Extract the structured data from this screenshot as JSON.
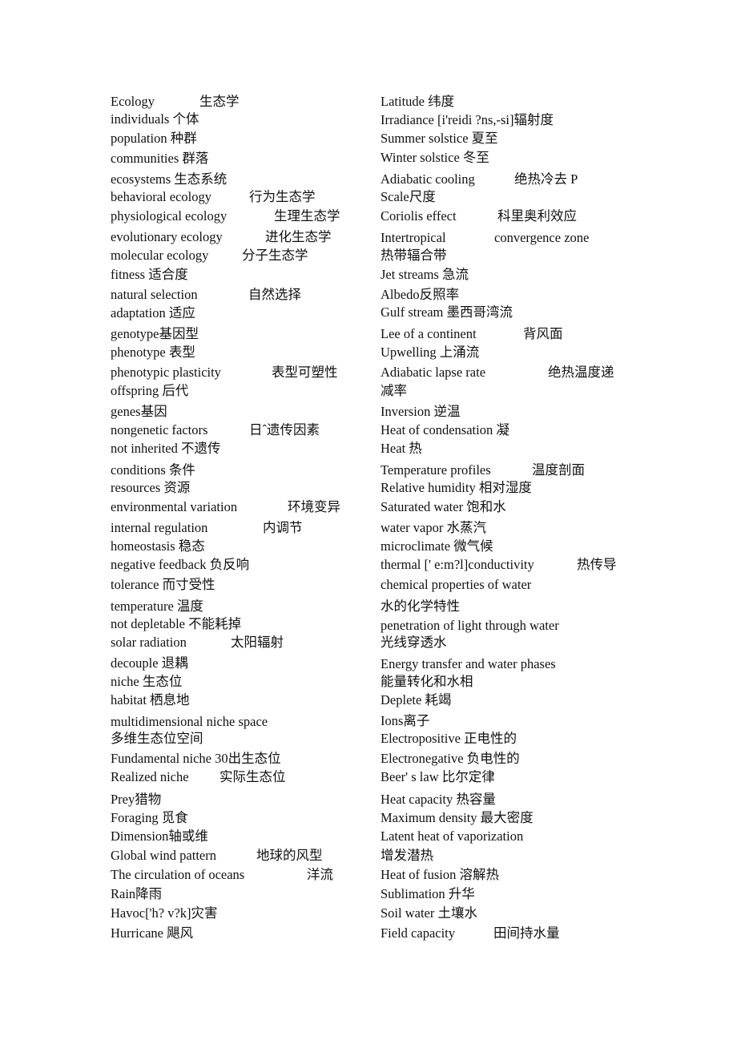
{
  "left": [
    {
      "term": "Ecology",
      "cn": "生态学"
    },
    {
      "term": "individuals 个体"
    },
    {
      "term": "population 种群"
    },
    {
      "term": "communities 群落"
    },
    {
      "term": "ecosystems 生态系统"
    },
    {
      "term": "behavioral ecology",
      "cn": "行为生态学"
    },
    {
      "term": "physiological ecology",
      "cn": "生理生态学"
    },
    {
      "term": "evolutionary ecology",
      "cn": "进化生态学"
    },
    {
      "term": "molecular ecology",
      "cn": "分子生态学"
    },
    {
      "term": "fitness 适合度"
    },
    {
      "term": "natural selection",
      "cn": "自然选择"
    },
    {
      "term": "adaptation 适应"
    },
    {
      "term": "genotype基因型"
    },
    {
      "term": "phenotype 表型"
    },
    {
      "term": "phenotypic plasticity",
      "cn": "表型可塑性"
    },
    {
      "term": "offspring 后代"
    },
    {
      "term": "genes基因"
    },
    {
      "term": "nongenetic factors",
      "cn": "日ˆ遗传因素"
    },
    {
      "term": "not inherited 不遗传"
    },
    {
      "term": "conditions 条件"
    },
    {
      "term": "resources 资源"
    },
    {
      "term": "environmental variation",
      "cn": "环境变异"
    },
    {
      "term": "internal regulation",
      "cn": "内调节"
    },
    {
      "term": "homeostasis 稳态"
    },
    {
      "term": "negative feedback 负反响"
    },
    {
      "term": "tolerance 而寸受性"
    },
    {
      "term": "temperature 温度"
    },
    {
      "term": "not depletable 不能耗掉"
    },
    {
      "term": "solar radiation",
      "cn": "太阳辐射"
    },
    {
      "term": "decouple 退耦"
    },
    {
      "term": "niche 生态位"
    },
    {
      "term": "habitat 栖息地"
    },
    {
      "term": "multidimensional niche space"
    },
    {
      "term": "多维生态位空间"
    },
    {
      "term": "Fundamental niche 30出生态位"
    },
    {
      "term": "Realized niche",
      "cn": "实际生态位"
    },
    {
      "term": "Prey猎物"
    },
    {
      "term": "Foraging 觅食"
    },
    {
      "term": "Dimension轴或维"
    },
    {
      "term": "Global wind pattern",
      "cn": "地球的风型"
    },
    {
      "term": "The circulation of oceans",
      "cn": "洋流"
    },
    {
      "term": "Rain降雨"
    },
    {
      "term": "Havoc['h? v?k]灾害"
    },
    {
      "term": "Hurricane 飓风"
    }
  ],
  "right": [
    {
      "term": "Latitude 纬度"
    },
    {
      "term": "Irradiance [i'reidi ?ns,-si]辐射度"
    },
    {
      "term": "Summer solstice 夏至"
    },
    {
      "term": "Winter solstice 冬至"
    },
    {
      "term": "Adiabatic cooling",
      "cn": "绝热冷去  P"
    },
    {
      "term": "Scale尺度"
    },
    {
      "term": "Coriolis effect",
      "cn": "科里奥利效应"
    },
    {
      "term": "Intertropical",
      "cn": "convergence zone"
    },
    {
      "term": "热带辐合带"
    },
    {
      "term": "Jet streams 急流"
    },
    {
      "term": "Albedo反照率"
    },
    {
      "term": "Gulf stream 墨西哥湾流"
    },
    {
      "term": "Lee of a continent",
      "cn": "背风面"
    },
    {
      "term": "Upwelling 上涌流"
    },
    {
      "term": "Adiabatic lapse rate",
      "cn": "绝热温度递"
    },
    {
      "term": "减率"
    },
    {
      "term": "Inversion 逆温"
    },
    {
      "term": "Heat of condensation 凝"
    },
    {
      "term": "Heat 热"
    },
    {
      "term": "Temperature profiles",
      "cn": "温度剖面"
    },
    {
      "term": "Relative humidity 相对湿度"
    },
    {
      "term": "Saturated water 饱和水"
    },
    {
      "term": "water vapor 水蒸汽"
    },
    {
      "term": "microclimate 微气候"
    },
    {
      "term": "thermal [' e:m?l]conductivity",
      "cn": "热传导"
    },
    {
      "term": "chemical properties of water"
    },
    {
      "term": "水的化学特性"
    },
    {
      "term": "penetration of light through water"
    },
    {
      "term": "光线穿透水"
    },
    {
      "term": "Energy transfer and water phases"
    },
    {
      "term": "能量转化和水相"
    },
    {
      "term": "Deplete 耗竭"
    },
    {
      "term": "Ions离子"
    },
    {
      "term": "Electropositive 正电性的"
    },
    {
      "term": "Electronegative 负电性的"
    },
    {
      "term": "Beer' s law 比尔定律"
    },
    {
      "term": "Heat capacity 热容量"
    },
    {
      "term": "Maximum density 最大密度"
    },
    {
      "term": "Latent heat of vaporization"
    },
    {
      "term": "增发潜热"
    },
    {
      "term": "Heat of fusion 溶解热"
    },
    {
      "term": "Sublimation 升华"
    },
    {
      "term": "Soil water 土壤水"
    },
    {
      "term": "Field capacity",
      "cn": "田间持水量"
    }
  ]
}
